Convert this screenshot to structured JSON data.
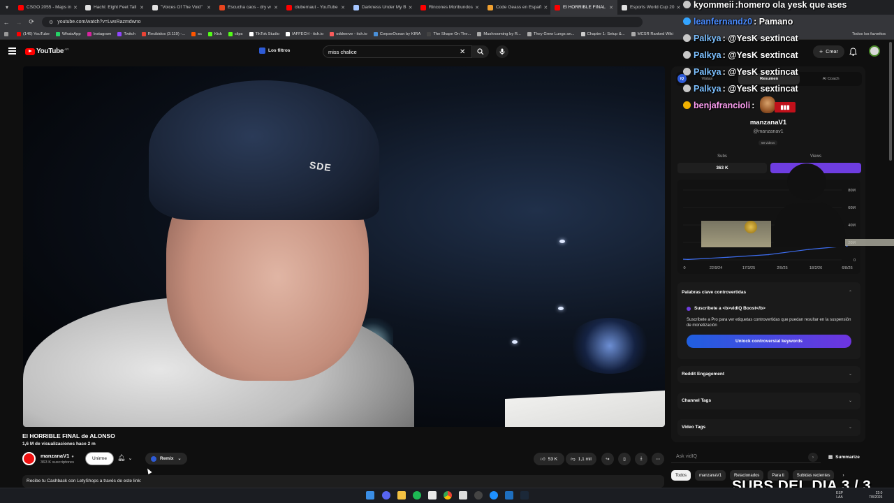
{
  "browser": {
    "tabs": [
      {
        "title": "CSGO 2055 - Maps in",
        "color": "#ff0000"
      },
      {
        "title": "Hachi: Eight Feet Tall",
        "color": "#e0e0e0"
      },
      {
        "title": "\"Voices Of The Void\"",
        "color": "#e0e0e0"
      },
      {
        "title": "Escucha caos - dry w",
        "color": "#e8451e"
      },
      {
        "title": "clubernaut - YouTube",
        "color": "#ff0000"
      },
      {
        "title": "Darkness Under My B",
        "color": "#a6c6ff"
      },
      {
        "title": "Rincones Moribundos",
        "color": "#ff0000"
      },
      {
        "title": "Code Geass en Españ",
        "color": "#f0a030"
      },
      {
        "title": "El HORRIBLE FINAL",
        "color": "#ff0000"
      },
      {
        "title": "Esports World Cup 20",
        "color": "#e0e0e0"
      }
    ],
    "url": "youtube.com/watch?v=LwxRazmdwno",
    "bookmarks": [
      {
        "label": "(146) YouTube",
        "color": "#ff0000"
      },
      {
        "label": "WhatsApp",
        "color": "#25d366"
      },
      {
        "label": "Instagram",
        "color": "#d6249f"
      },
      {
        "label": "Twitch",
        "color": "#9146ff"
      },
      {
        "label": "Recibidos (3.119) -...",
        "color": "#ea4335"
      },
      {
        "label": "sc",
        "color": "#ff5500"
      },
      {
        "label": "Kick",
        "color": "#53fc18"
      },
      {
        "label": "clips",
        "color": "#53fc18"
      },
      {
        "label": "TikTok Studio",
        "color": "#ffffff"
      },
      {
        "label": "IAFFECH - itch.io",
        "color": "#ffffff"
      },
      {
        "label": "oddnerve - itch.io",
        "color": "#fa5c5c"
      },
      {
        "label": "CorpseOcean by KIRA",
        "color": "#4a90d9"
      },
      {
        "label": "The Shape On The...",
        "color": "#444444"
      },
      {
        "label": "Mushrooming by R...",
        "color": "#aaaaaa"
      },
      {
        "label": "They Grew Lungs an...",
        "color": "#aaaaaa"
      },
      {
        "label": "Chapter 1: Setup &...",
        "color": "#cccccc"
      },
      {
        "label": "MCSR Ranked Wiki",
        "color": "#aaaaaa"
      }
    ],
    "all_bookmarks": "Todos los favoritos"
  },
  "youtube": {
    "logo_text": "YouTube",
    "country_code": "AR",
    "filters_label": "Los filtros",
    "search_value": "miss chalice",
    "create_label": "Crear"
  },
  "video": {
    "beanie_logo": "SDE",
    "title": "El HORRIBLE FINAL de ALONSO",
    "meta": "1,6 M de visualizaciones  hace 2 m",
    "channel_name": "manzanaV1",
    "channel_subs": "363 K suscriptores",
    "join_label": "Unirme",
    "remix_label": "Remix",
    "likes": "53 K",
    "dislikes": "1,1 mil",
    "description": "Recibe tu Cashback con LetyShops a través de este link:"
  },
  "vidiq": {
    "tabs": [
      "Vistas",
      "Resumen",
      "AI Coach"
    ],
    "active_tab": "Resumen",
    "channel_name": "manzanaV1",
    "handle": "@manzanav1",
    "videos_count": "58 videos",
    "subs_label": "Subs",
    "views_label": "Views",
    "subs_value": "363 K",
    "keywords_title": "Palabras clave controvertidas",
    "keywords_sub_title": "Suscríbete a <b>vidIQ Boost</b>",
    "keywords_desc": "Suscríbete a Pro para ver etiquetas controvertidas que puedan resultar en la suspensión de monetización",
    "unlock_label": "Unlock controversial keywords",
    "reddit_label": "Reddit Engagement",
    "channel_tags_label": "Channel Tags",
    "video_tags_label": "Video Tags",
    "ask_placeholder": "Ask vidIQ",
    "summarize_label": "Summarize"
  },
  "chips": [
    "Todos",
    "manzanaV1",
    "Relacionados",
    "Para ti",
    "Subidas recientes"
  ],
  "chart_data": {
    "type": "line",
    "x": [
      "22/9/24",
      "17/3/25",
      "2/9/25",
      "18/2/26",
      "6/8/26"
    ],
    "series": [
      {
        "values": [
          0.5,
          3,
          6,
          12,
          16
        ]
      }
    ],
    "yticks": [
      "0",
      "20M",
      "40M",
      "60M",
      "80M"
    ],
    "ylim": [
      0,
      80
    ]
  },
  "chat": [
    {
      "user": "kyommeii",
      "color": "#ffffff",
      "msg": ":homero ola yesk que ases"
    },
    {
      "user": "leanfernandz0",
      "color": "#4a8cff",
      "msg": ": Pamano"
    },
    {
      "user": "Palkya",
      "color": "#7cc0ff",
      "msg": ": @YesK sextincat"
    },
    {
      "user": "Palkya",
      "color": "#7cc0ff",
      "msg": ": @YesK sextincat"
    },
    {
      "user": "Palkya",
      "color": "#7cc0ff",
      "msg": ": @YesK sextincat"
    },
    {
      "user": "Palkya",
      "color": "#7cc0ff",
      "msg": ": @YesK sextincat"
    },
    {
      "user": "benjafrancioli",
      "color": "#ff9ff3",
      "msg": ":"
    }
  ],
  "overlay_subs": "SUBS DEL DIA 3 / 3",
  "taskbar": {
    "lang": "ESP\nLAA",
    "time": "22:0\n7/8/2026"
  },
  "colors": {
    "accent": "#6e3de0",
    "brand_red": "#ff0000"
  }
}
